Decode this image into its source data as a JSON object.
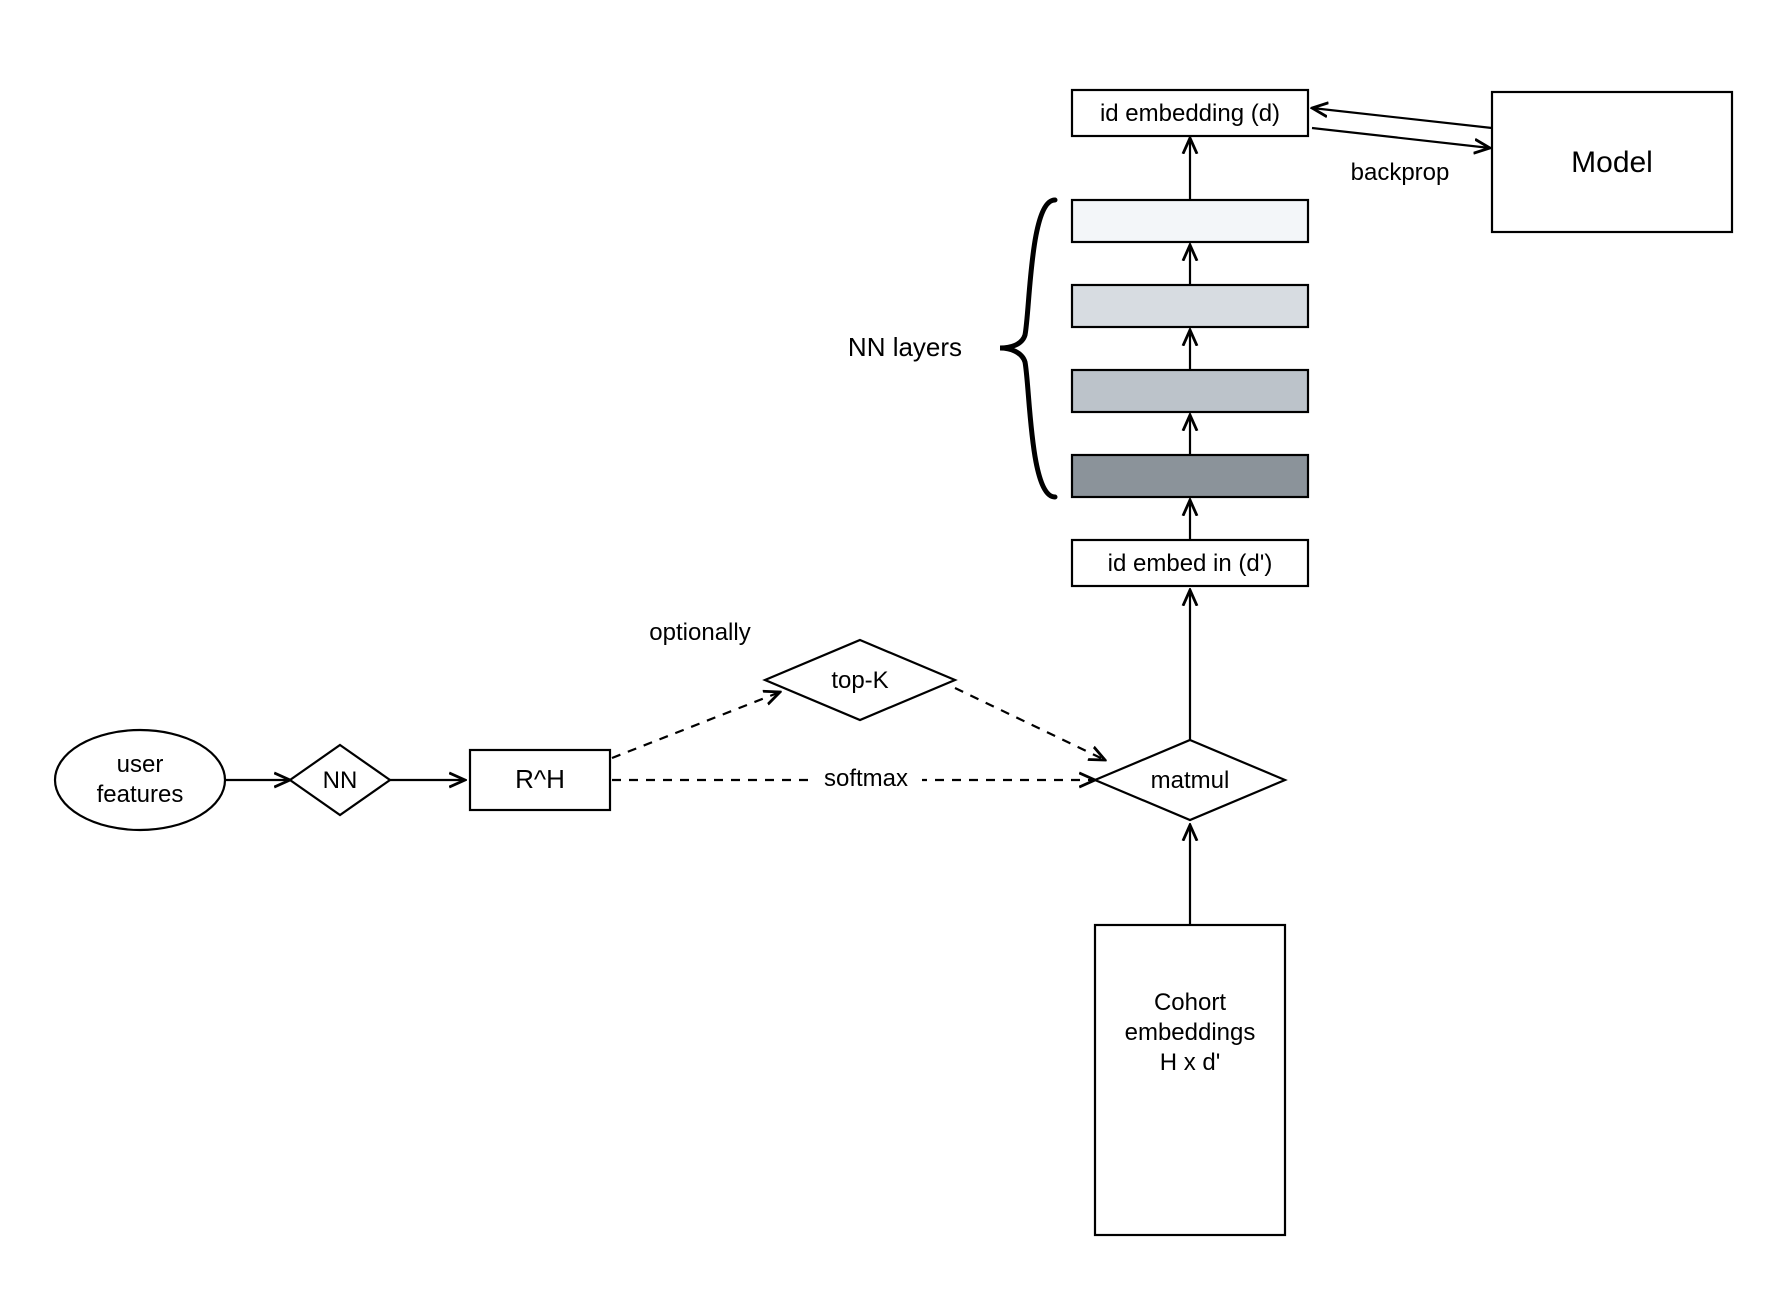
{
  "nodes": {
    "user_features": "user\nfeatures",
    "nn": "NN",
    "rh": "R^H",
    "topk": "top-K",
    "optionally": "optionally",
    "softmax": "softmax",
    "matmul": "matmul",
    "cohort": "Cohort\nembeddings\nH x d'",
    "id_embed_in": "id embed in (d')",
    "nn_layers": "NN layers",
    "id_embedding_d": "id embedding (d)",
    "backprop": "backprop",
    "model": "Model"
  },
  "layer_colors": [
    "#8b939a",
    "#bcc3ca",
    "#d7dce1",
    "#f3f6f9"
  ]
}
